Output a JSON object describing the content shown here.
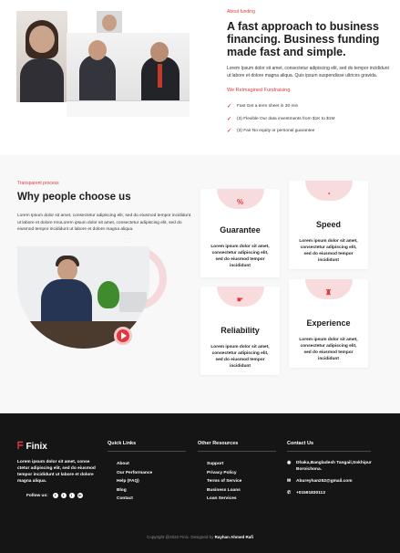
{
  "about": {
    "eyebrow": "About funding",
    "title": "A fast approach to business financing. Business funding made fast and simple.",
    "description": "Lorem Ipsum dolor sit amet, consectetur adipiscing elit, sed do tempor incididunt ut labore et dolore magna aliqua. Quis ipsum suspendisse ultrices gravida.",
    "subheading": "We Reimagined Fundraising.",
    "checks": [
      "Fast Get a term sheet in 30 min",
      "(3) Flexible Our data investments from $1K to $1M",
      "(3) Fair No equity or personal guarantee"
    ]
  },
  "why": {
    "eyebrow": "Transparent process",
    "title": "Why people choose us",
    "description": "Lorem Ipsum dolor sit amet, consectetur adipiscing elit, sed do eiusmod tempor incididunt ut labore et dolore ImoLorem ipsum dolor sit amet, consectetur adipiscing elit, sed do eiusmod tempor incididunt ut labore et dolore magna aliqua.",
    "cards": [
      {
        "icon": "percent-icon",
        "glyph": "%",
        "title": "Guarantee",
        "text": "Lorem ipsum dolor sit amet, consectetur adipiscing elit, sed do eiusmod tempor incididunt"
      },
      {
        "icon": "clock-icon",
        "glyph": "◔",
        "title": "Speed",
        "text": "Lorem ipsum dolor sit amet, consectetur adipiscing elit, sed do eiusmod tempor incididunt"
      },
      {
        "icon": "handshake-icon",
        "glyph": "☛",
        "title": "Reliability",
        "text": "Lorem ipsum dolor sit amet, consectetur adipiscing elit, sed do eiusmod tempor incididunt"
      },
      {
        "icon": "team-icon",
        "glyph": "♜",
        "title": "Experience",
        "text": "Lorem ipsum dolor sit amet, consectetur adipiscing elit, sed do eiusmod tempor incididunt"
      }
    ]
  },
  "footer": {
    "brand": "Finix",
    "description": "Lorem ipsum dolor sit amet, conse ctetur adipiscing elit, sed do eiusmod tempor incididunt ut labore et dolore magna aliqua.",
    "follow_label": "Follow us:",
    "social": [
      "f",
      "t",
      "i",
      "in"
    ],
    "quick_links": {
      "heading": "Quick Links",
      "items": [
        "About",
        "Our Performance",
        "Help (FAQ)",
        "Blog",
        "Contact"
      ]
    },
    "other_resources": {
      "heading": "Other Resources",
      "items": [
        "Support",
        "Privacy Policy",
        "Terms of Service",
        "Business Loans",
        "Loan Services"
      ]
    },
    "contact": {
      "heading": "Contact Us",
      "address": "Dhaka,Bangladesh Tangail,Sokhipur Boroichona.",
      "email": "Abureyhan252@gmail.com",
      "phone": "+01591830113"
    },
    "copyright_prefix": "Copyright @2022 Finix. Designed by",
    "copyright_author": "Rayhan Ahmed Rafi"
  },
  "colors": {
    "accent": "#e0383e",
    "accent_soft": "#f8dcdd",
    "footer_bg": "#151515",
    "section_bg": "#f8f8f8"
  }
}
